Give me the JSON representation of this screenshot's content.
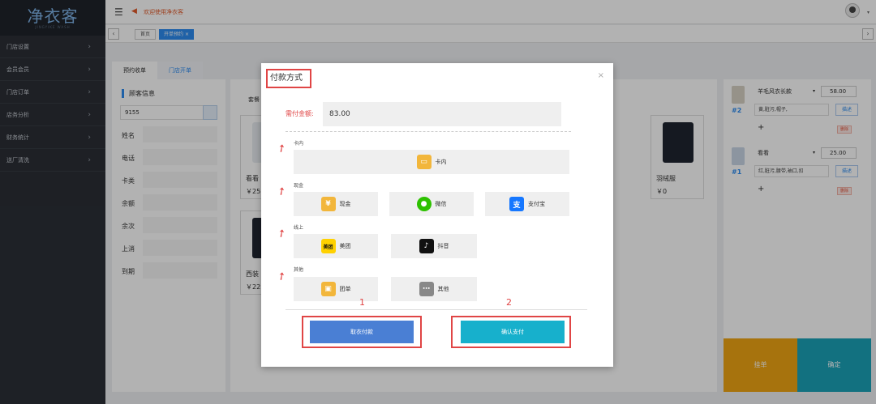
{
  "brand": {
    "logo": "净衣客",
    "logo_sub": "JINGYIKE WASH"
  },
  "sidebar": {
    "items": [
      {
        "label": "门店设置"
      },
      {
        "label": "会员会员"
      },
      {
        "label": "门店订单"
      },
      {
        "label": "店务分析"
      },
      {
        "label": "财务统计"
      },
      {
        "label": "送厂清洗"
      }
    ]
  },
  "topbar": {
    "notice": "欢迎使用净衣客",
    "menu_icon": "hamburger-icon",
    "notice_icon": "megaphone-icon"
  },
  "tabs": {
    "home": "首页",
    "active": "开单预约"
  },
  "sub_tabs": [
    {
      "label": "预约收单"
    },
    {
      "label": "门店开单"
    }
  ],
  "customer": {
    "title": "顾客信息",
    "phone": "9155",
    "fields": [
      {
        "label": "姓名"
      },
      {
        "label": "电话"
      },
      {
        "label": "卡类"
      },
      {
        "label": "余额"
      },
      {
        "label": "余次"
      },
      {
        "label": "上消"
      },
      {
        "label": "到期"
      }
    ]
  },
  "goods": {
    "label": "套餐",
    "cards": [
      {
        "name": "看看",
        "price": "￥25"
      },
      {
        "name": "西装",
        "price": "￥22"
      },
      {
        "name": "羽绒服",
        "price": "￥0"
      }
    ]
  },
  "order": {
    "items": [
      {
        "num": "#2",
        "title": "羊毛风衣长款",
        "price": "58.00",
        "note": "黄,脏污,帽子,",
        "desc": "描述",
        "del": "删除"
      },
      {
        "num": "#1",
        "title": "看看",
        "price": "25.00",
        "note": "红,脏污,腰带,袖口,扣",
        "desc": "描述",
        "del": "删除"
      }
    ],
    "hang": "挂单",
    "confirm": "确定"
  },
  "modal": {
    "title": "付款方式",
    "close": "×",
    "amount_label": "需付金额:",
    "amount": "83.00",
    "categories": [
      {
        "label": "卡内",
        "buttons": [
          {
            "label": "卡内",
            "icon": "card-icon",
            "color": "#f2b63b"
          }
        ]
      },
      {
        "label": "现金",
        "buttons": [
          {
            "label": "现金",
            "icon": "yen-icon",
            "color": "#f2b63b"
          },
          {
            "label": "微信",
            "icon": "wechat-icon",
            "color": "#2dc100"
          },
          {
            "label": "支付宝",
            "icon": "alipay-icon",
            "color": "#1677ff"
          }
        ]
      },
      {
        "label": "线上",
        "buttons": [
          {
            "label": "美团",
            "icon": "meituan-icon",
            "color": "#ffd100"
          },
          {
            "label": "抖音",
            "icon": "douyin-icon",
            "color": "#111111"
          }
        ]
      },
      {
        "label": "其他",
        "buttons": [
          {
            "label": "团单",
            "icon": "group-order-icon",
            "color": "#f2b63b"
          },
          {
            "label": "其他",
            "icon": "more-icon",
            "color": "#888888"
          }
        ]
      }
    ],
    "cancel": "取衣付款",
    "confirm": "确认支付",
    "step1": "1",
    "step2": "2",
    "colors": {
      "cancel": "#4a7fd4",
      "confirm": "#17b0cc",
      "annotation": "#e04545"
    }
  }
}
